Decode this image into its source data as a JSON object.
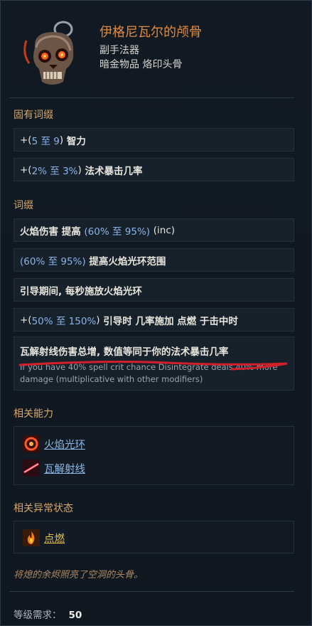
{
  "item": {
    "name": "伊格尼瓦尔的颅骨",
    "subtype": "副手法器",
    "rarity_line": "暗金物品 烙印头骨"
  },
  "implicit": {
    "header": "固有词缀",
    "mods": [
      {
        "prefix": "+(",
        "range": "5 至 9",
        "suffix": ")",
        "text": "智力"
      },
      {
        "prefix": "+(",
        "range": "2% 至 3%",
        "suffix": ")",
        "text": "法术暴击几率"
      }
    ]
  },
  "affixes": {
    "header": "词缀",
    "mods": [
      {
        "prefix": "",
        "text": "火焰伤害 提高",
        "range": "(60% 至 95%)",
        "after": "(inc)"
      },
      {
        "prefix": "",
        "range": "(60% 至 95%)",
        "text": "提高火焰光环范围"
      },
      {
        "text": "引导期间, 每秒施放火焰光环"
      },
      {
        "prefix": "+(",
        "range": "50% 至 150%",
        "suffix": ")",
        "text": "引导时 几率施加 点燃 于击中时"
      }
    ],
    "special": {
      "text": "瓦解射线伤害总增, 数值等同于你的法术暴击几率",
      "description": "If you have 40% spell crit chance Disintegrate deals 40% more damage (multiplicative with other modifiers)"
    }
  },
  "abilities": {
    "header": "相关能力",
    "items": [
      {
        "label": "火焰光环",
        "icon": "fire-aura-icon"
      },
      {
        "label": "瓦解射线",
        "icon": "disintegrate-icon"
      }
    ]
  },
  "statuses": {
    "header": "相关异常状态",
    "items": [
      {
        "label": "点燃",
        "icon": "ignite-icon"
      }
    ]
  },
  "flavor": "将熄的余烬照亮了空洞的头骨。",
  "requirement": {
    "label": "等级需求：",
    "value": "50"
  },
  "colors": {
    "title": "#e28a3e",
    "section": "#d8a76b",
    "range": "#8ab4e8",
    "link": "#8bb8e6",
    "status_link": "#e9bf4a",
    "annotation": "#d2202a"
  }
}
